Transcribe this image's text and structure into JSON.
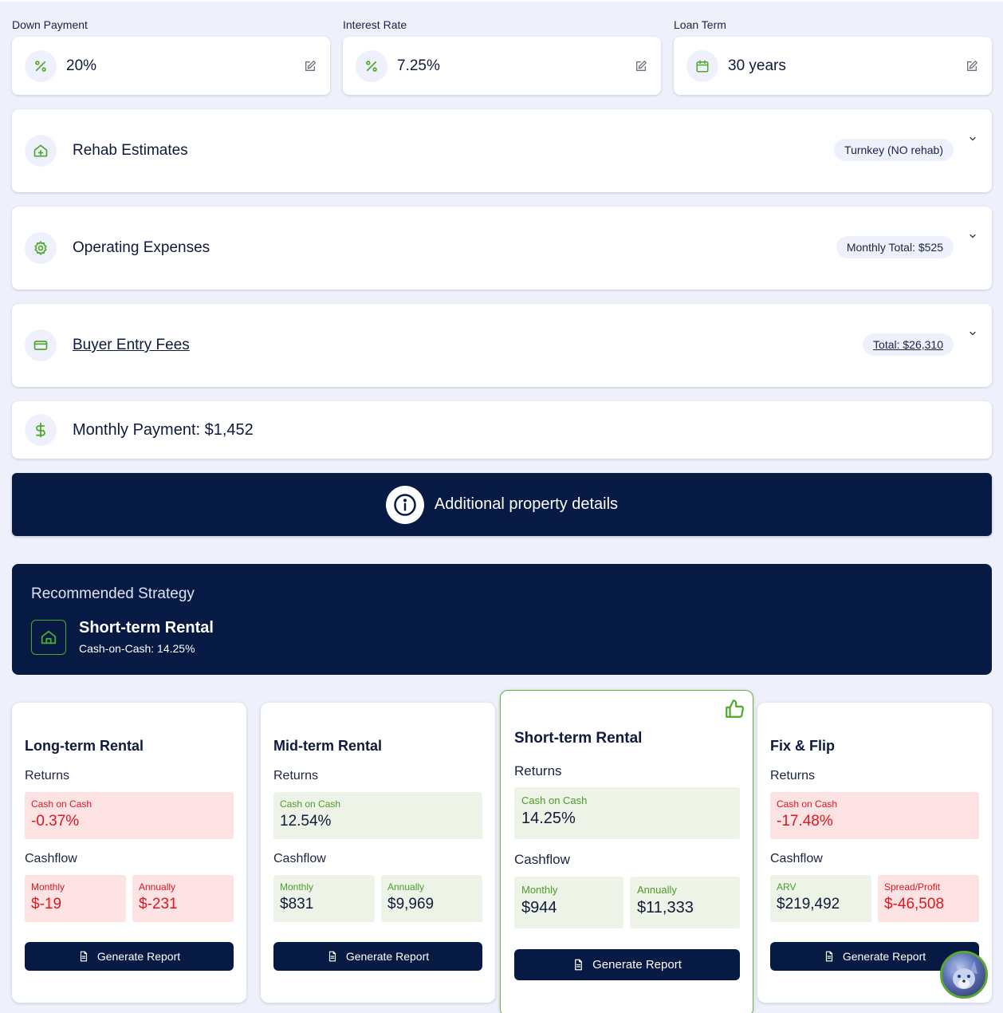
{
  "loan_params": [
    {
      "label": "Down Payment",
      "value": "20%",
      "icon": "percent-icon"
    },
    {
      "label": "Interest Rate",
      "value": "7.25%",
      "icon": "percent-icon"
    },
    {
      "label": "Loan Term",
      "value": "30 years",
      "icon": "calendar-icon"
    }
  ],
  "sections": {
    "rehab": {
      "title": "Rehab Estimates",
      "pill": "Turnkey (NO rehab)",
      "icon": "house-plus-icon"
    },
    "operating": {
      "title": "Operating Expenses",
      "pill": "Monthly Total: $525",
      "icon": "gear-icon"
    },
    "entry_fees": {
      "title": "Buyer Entry Fees",
      "pill": "Total: $26,310",
      "icon": "credit-card-icon"
    },
    "payment": {
      "title": "Monthly Payment: $1,452",
      "icon": "dollar-icon"
    }
  },
  "details_button": {
    "label": "Additional property details",
    "icon": "info-icon"
  },
  "recommended": {
    "title": "Recommended Strategy",
    "name": "Short-term Rental",
    "metric": "Cash-on-Cash: 14.25%",
    "icon": "house-icon"
  },
  "strategies": [
    {
      "title": "Long-term Rental",
      "returns_label": "Returns",
      "coc_label": "Cash on Cash",
      "coc_value": "-0.37%",
      "coc_status": "negative",
      "cashflow_label": "Cashflow",
      "left_label": "Monthly",
      "left_value": "$-19",
      "left_status": "negative",
      "right_label": "Annually",
      "right_value": "$-231",
      "right_status": "negative",
      "button": "Generate Report"
    },
    {
      "title": "Mid-term Rental",
      "returns_label": "Returns",
      "coc_label": "Cash on Cash",
      "coc_value": "12.54%",
      "coc_status": "positive",
      "cashflow_label": "Cashflow",
      "left_label": "Monthly",
      "left_value": "$831",
      "left_status": "positive",
      "right_label": "Annually",
      "right_value": "$9,969",
      "right_status": "positive",
      "button": "Generate Report"
    },
    {
      "title": "Short-term Rental",
      "returns_label": "Returns",
      "coc_label": "Cash on Cash",
      "coc_value": "14.25%",
      "coc_status": "positive",
      "cashflow_label": "Cashflow",
      "left_label": "Monthly",
      "left_value": "$944",
      "left_status": "positive",
      "right_label": "Annually",
      "right_value": "$11,333",
      "right_status": "positive",
      "button": "Generate Report",
      "featured": true,
      "badge_icon": "thumbs-up-icon"
    },
    {
      "title": "Fix & Flip",
      "returns_label": "Returns",
      "coc_label": "Cash on Cash",
      "coc_value": "-17.48%",
      "coc_status": "negative",
      "cashflow_label": "Cashflow",
      "left_label": "ARV",
      "left_value": "$219,492",
      "left_status": "positive",
      "right_label": "Spread/Profit",
      "right_value": "$-46,508",
      "right_status": "negative",
      "button": "Generate Report"
    }
  ],
  "colors": {
    "navy": "#071a44",
    "green": "#4fa82a",
    "negative": "#d8191f",
    "positive_bg": "#edf3e6",
    "negative_bg": "#fde3e4"
  },
  "assistant_avatar": {
    "icon": "wolf-avatar-icon"
  }
}
